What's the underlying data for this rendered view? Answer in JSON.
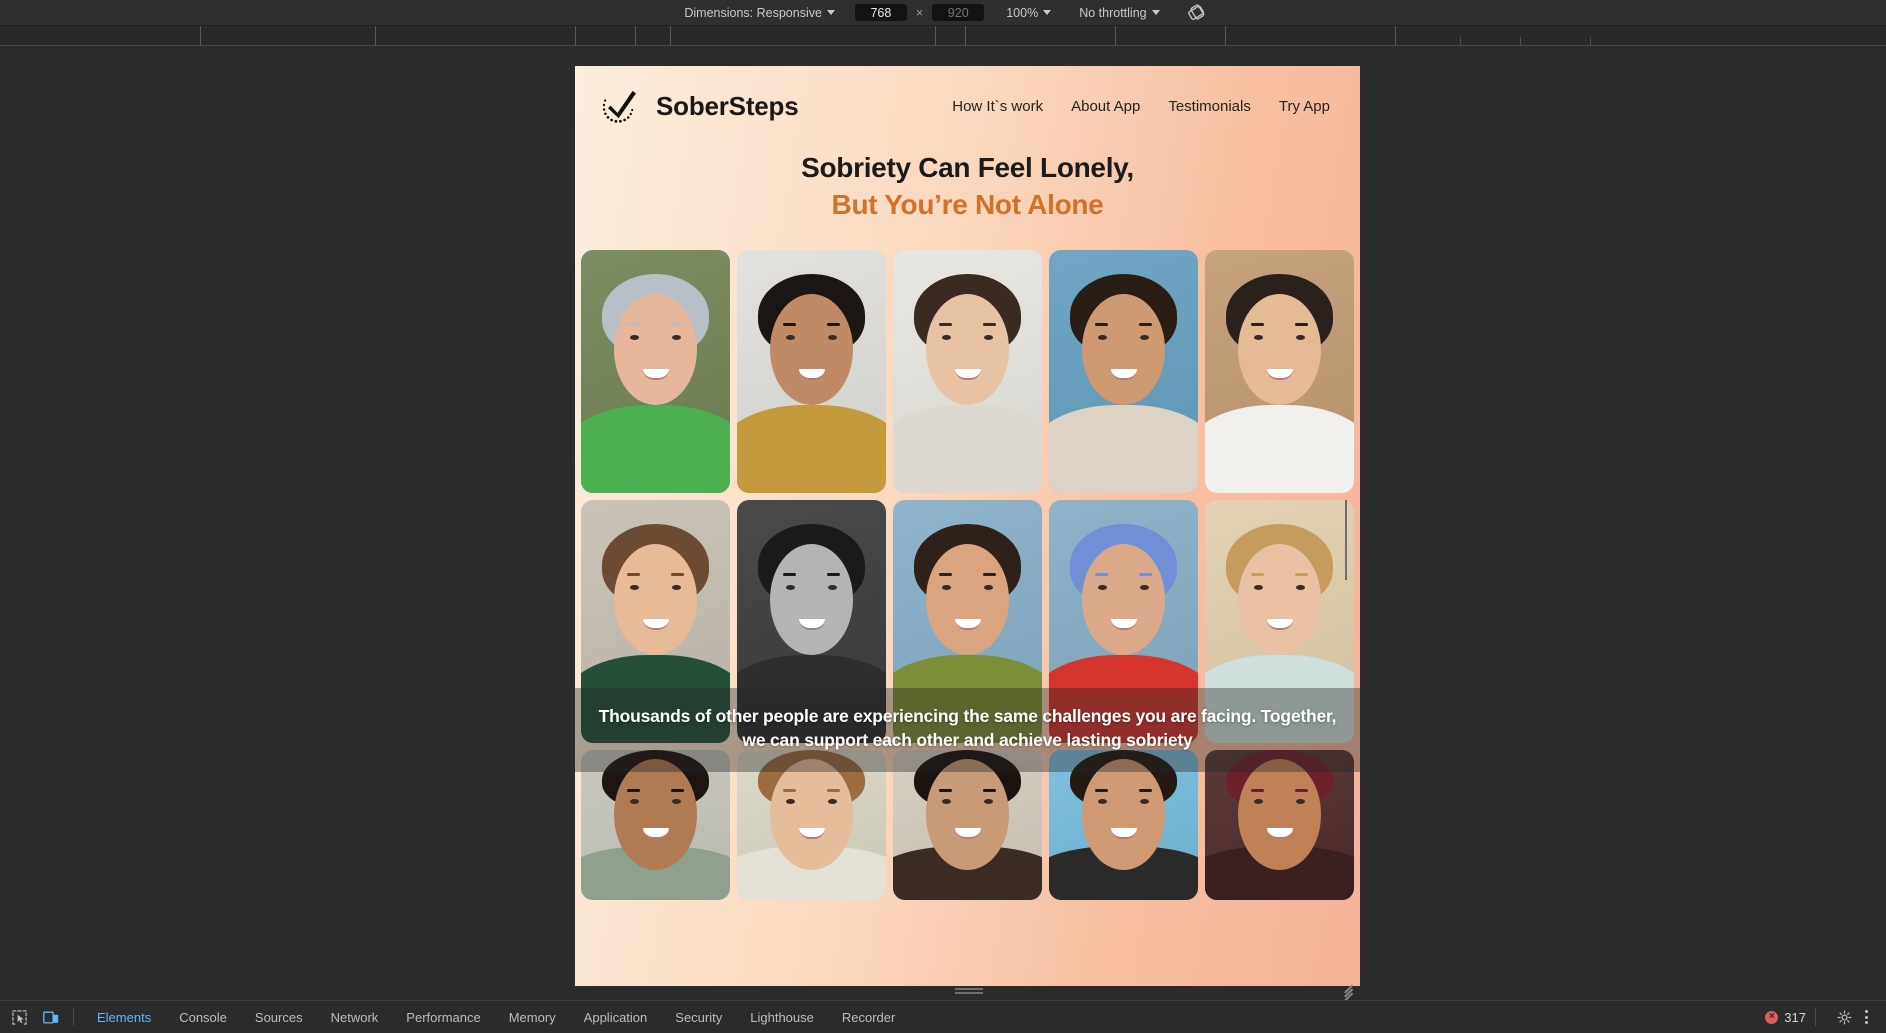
{
  "devtools": {
    "toolbar": {
      "dimensions_label": "Dimensions: Responsive",
      "width_value": "768",
      "height_placeholder": "920",
      "multiply": "×",
      "zoom_label": "100%",
      "throttle_label": "No throttling",
      "rotate_icon": "rotate-device-icon"
    },
    "panel_tabs": [
      {
        "label": "Elements",
        "active": true
      },
      {
        "label": "Console",
        "active": false
      },
      {
        "label": "Sources",
        "active": false
      },
      {
        "label": "Network",
        "active": false
      },
      {
        "label": "Performance",
        "active": false
      },
      {
        "label": "Memory",
        "active": false
      },
      {
        "label": "Application",
        "active": false
      },
      {
        "label": "Security",
        "active": false
      },
      {
        "label": "Lighthouse",
        "active": false
      },
      {
        "label": "Recorder",
        "active": false
      }
    ],
    "left_icons": [
      {
        "name": "inspect-element-icon"
      },
      {
        "name": "device-toolbar-toggle-icon"
      }
    ],
    "status": {
      "error_count": "317",
      "error_glyph": "×",
      "settings_icon": "gear-icon",
      "more_icon": "kebab-menu-icon"
    }
  },
  "site": {
    "brand": "SoberSteps",
    "logo_icon": "check-in-dotted-circle-icon",
    "nav": [
      {
        "label": "How It`s work"
      },
      {
        "label": "About App"
      },
      {
        "label": "Testimonials"
      },
      {
        "label": "Try App"
      }
    ],
    "headline": {
      "line1": "Sobriety Can Feel Lonely,",
      "line2": "But You’re Not Alone",
      "line2_color": "#d2722a"
    },
    "overlay_paragraph": "Thousands of other people are experiencing the same challenges you are facing. Together, we can support each other and achieve lasting sobriety",
    "gallery": [
      {
        "alt": "woman-short-gray-hair-green-top",
        "bg": "#7d8d62",
        "skin": "#e6b79a",
        "hair": "#b9bfc6",
        "cloth": "#4caf50",
        "gray": false
      },
      {
        "alt": "woman-curly-black-hair-smiling",
        "bg": "#e2e1dd",
        "skin": "#c08a64",
        "hair": "#1c1613",
        "cloth": "#c49a3c",
        "gray": false
      },
      {
        "alt": "young-man-long-hair-backpack",
        "bg": "#e9e7e2",
        "skin": "#e8c3a3",
        "hair": "#3b2a22",
        "cloth": "#ddd8cf",
        "gray": false
      },
      {
        "alt": "teen-boy-curly-hair-fountain",
        "bg": "#6fa7c4",
        "skin": "#cf9a72",
        "hair": "#2a1d16",
        "cloth": "#ddd3c4",
        "gray": false
      },
      {
        "alt": "older-woman-glasses-white-blouse",
        "bg": "#c6a37e",
        "skin": "#e5bb96",
        "hair": "#2a211c",
        "cloth": "#f2f0ec",
        "gray": false
      },
      {
        "alt": "man-green-hoodie-smiling",
        "bg": "#c9c3b8",
        "skin": "#e8bb98",
        "hair": "#6b4b33",
        "cloth": "#24503a",
        "gray": false
      },
      {
        "alt": "woman-black-and-white-portrait",
        "bg": "#4a4a4a",
        "skin": "#b4b4b4",
        "hair": "#1a1a1a",
        "cloth": "#2e2e2e",
        "gray": true
      },
      {
        "alt": "woman-olive-sweater-leaning",
        "bg": "#8fb4cc",
        "skin": "#d9a47e",
        "hair": "#2e211a",
        "cloth": "#7d8f36",
        "gray": false
      },
      {
        "alt": "older-man-blue-hair-red-shirt",
        "bg": "#8fb3c9",
        "skin": "#dba98a",
        "hair": "#6f8fd6",
        "cloth": "#d6352e",
        "gray": false
      },
      {
        "alt": "woman-long-blonde-hair-sunlight",
        "bg": "#e4d3b2",
        "skin": "#e8c2a2",
        "hair": "#c79a5e",
        "cloth": "#cfe0dc",
        "gray": false
      },
      {
        "alt": "man-smiling-outdoors",
        "bg": "#c9c9c0",
        "skin": "#b07a52",
        "hair": "#1d1512",
        "cloth": "#8fa08e",
        "gray": false
      },
      {
        "alt": "woman-braces-laughing",
        "bg": "#dcd9c8",
        "skin": "#e6bd9b",
        "hair": "#9a6c40",
        "cloth": "#e3e0d6",
        "gray": false
      },
      {
        "alt": "woman-dark-hair-closeup",
        "bg": "#d8cfc3",
        "skin": "#c89a76",
        "hair": "#1b1310",
        "cloth": "#3a2c24",
        "gray": false
      },
      {
        "alt": "woman-dark-hair-blue-sky",
        "bg": "#7fc0de",
        "skin": "#cf9a74",
        "hair": "#241a14",
        "cloth": "#2a2a2a",
        "gray": false
      },
      {
        "alt": "man-burgundy-hair-beard",
        "bg": "#5c3a3a",
        "skin": "#c08156",
        "hair": "#6e1f2e",
        "cloth": "#3a2020",
        "gray": false
      }
    ]
  }
}
